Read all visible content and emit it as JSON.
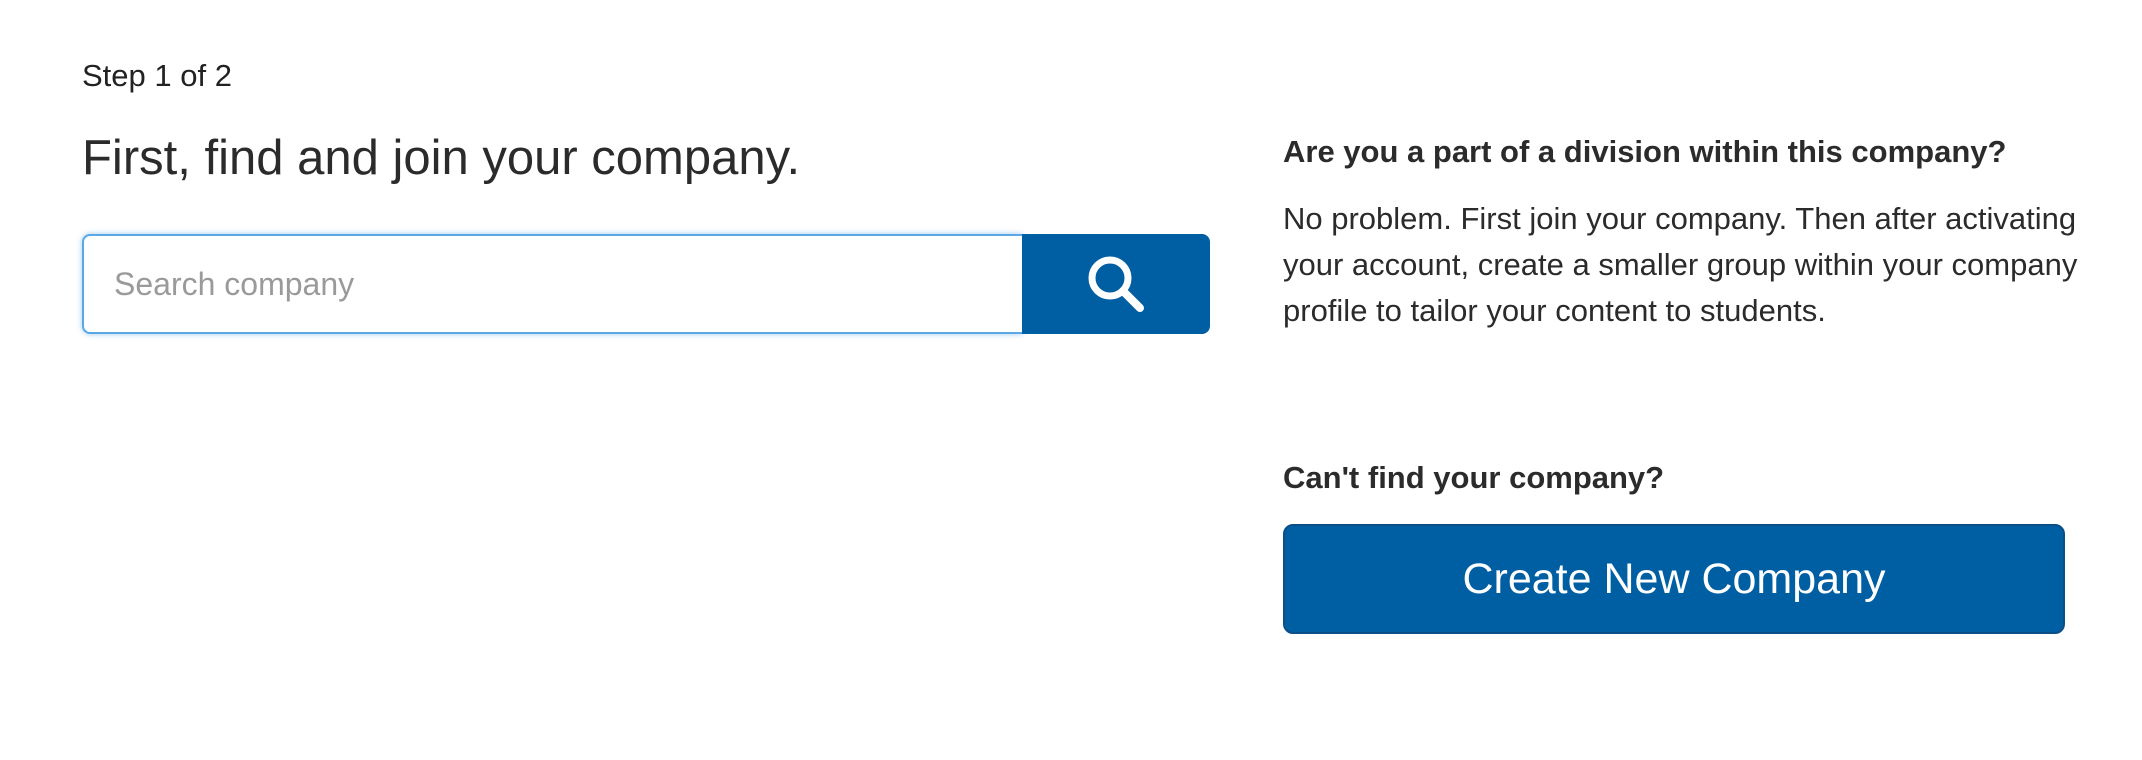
{
  "join": {
    "step_label": "Step 1 of 2",
    "title": "First, find and join your company.",
    "search": {
      "placeholder": "Search company",
      "value": "",
      "button_icon": "search-icon"
    }
  },
  "sidebar": {
    "division_heading": "Are you a part of a division within this company?",
    "division_body": "No problem. First join your company. Then after activating your account, create a smaller group within your company profile to tailor your content to students.",
    "cant_find_heading": "Can't find your company?",
    "create_button_label": "Create New Company"
  },
  "colors": {
    "primary": "#005ea2",
    "input_focus_border": "#5aa7e6",
    "text": "#2b2b2b"
  }
}
